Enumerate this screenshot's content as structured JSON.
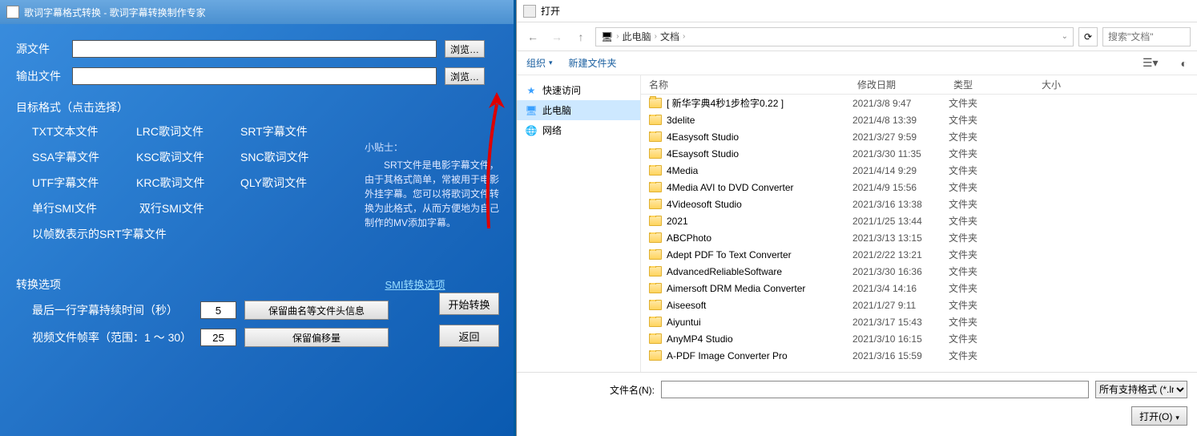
{
  "app": {
    "title": "歌词字幕格式转换 - 歌词字幕转换制作专家",
    "source_label": "源文件",
    "output_label": "输出文件",
    "source_value": "",
    "output_value": "",
    "browse": "浏览…",
    "target_format_title": "目标格式（点击选择）",
    "formats": [
      "TXT文本文件",
      "LRC歌词文件",
      "SRT字幕文件",
      "SSA字幕文件",
      "KSC歌词文件",
      "SNC歌词文件",
      "UTF字幕文件",
      "KRC歌词文件",
      "QLY歌词文件"
    ],
    "format_row2": [
      "单行SMI文件",
      "双行SMI文件"
    ],
    "format_row3": "以帧数表示的SRT字幕文件",
    "tips_head": "小贴士：",
    "tips_body": "　　SRT文件是电影字幕文件，由于其格式简单，常被用于电影外挂字幕。您可以将歌词文件转换为此格式，从而方便地为自己制作的MV添加字幕。",
    "convert_options_title": "转换选项",
    "smi_link": "SMI转换选项",
    "last_line_label": "最后一行字幕持续时间（秒）",
    "last_line_value": "5",
    "fps_label": "视频文件帧率（范围：1 ～ 30）",
    "fps_value": "25",
    "keep_header": "保留曲名等文件头信息",
    "keep_offset": "保留偏移量",
    "start_convert": "开始转换",
    "back": "返回"
  },
  "dialog": {
    "title": "打开",
    "breadcrumbs": [
      "此电脑",
      "文档"
    ],
    "search_placeholder": "搜索\"文档\"",
    "organize": "组织",
    "new_folder": "新建文件夹",
    "sidebar": [
      {
        "icon": "★",
        "label": "快速访问",
        "color": "#3aa0ff"
      },
      {
        "icon": "🖥",
        "label": "此电脑",
        "color": "#3aa0ff",
        "selected": true
      },
      {
        "icon": "🌐",
        "label": "网络",
        "color": "#3aa0ff"
      }
    ],
    "columns": [
      "名称",
      "修改日期",
      "类型",
      "大小"
    ],
    "files": [
      {
        "name": "[ 新华字典4秒1步检字0.22 ]",
        "date": "2021/3/8 9:47",
        "type": "文件夹"
      },
      {
        "name": "3delite",
        "date": "2021/4/8 13:39",
        "type": "文件夹"
      },
      {
        "name": "4Easysoft Studio",
        "date": "2021/3/27 9:59",
        "type": "文件夹"
      },
      {
        "name": "4Esaysoft Studio",
        "date": "2021/3/30 11:35",
        "type": "文件夹"
      },
      {
        "name": "4Media",
        "date": "2021/4/14 9:29",
        "type": "文件夹"
      },
      {
        "name": "4Media AVI to DVD Converter",
        "date": "2021/4/9 15:56",
        "type": "文件夹"
      },
      {
        "name": "4Videosoft Studio",
        "date": "2021/3/16 13:38",
        "type": "文件夹"
      },
      {
        "name": "2021",
        "date": "2021/1/25 13:44",
        "type": "文件夹"
      },
      {
        "name": "ABCPhoto",
        "date": "2021/3/13 13:15",
        "type": "文件夹"
      },
      {
        "name": "Adept PDF To Text Converter",
        "date": "2021/2/22 13:21",
        "type": "文件夹"
      },
      {
        "name": "AdvancedReliableSoftware",
        "date": "2021/3/30 16:36",
        "type": "文件夹"
      },
      {
        "name": "Aimersoft DRM Media Converter",
        "date": "2021/3/4 14:16",
        "type": "文件夹"
      },
      {
        "name": "Aiseesoft",
        "date": "2021/1/27 9:11",
        "type": "文件夹"
      },
      {
        "name": "Aiyuntui",
        "date": "2021/3/17 15:43",
        "type": "文件夹"
      },
      {
        "name": "AnyMP4 Studio",
        "date": "2021/3/10 16:15",
        "type": "文件夹"
      },
      {
        "name": "A-PDF Image Converter Pro",
        "date": "2021/3/16 15:59",
        "type": "文件夹"
      }
    ],
    "filename_label": "文件名(N):",
    "filename_value": "",
    "filter": "所有支持格式 (*.lrc,",
    "open_btn": "打开(O)"
  }
}
